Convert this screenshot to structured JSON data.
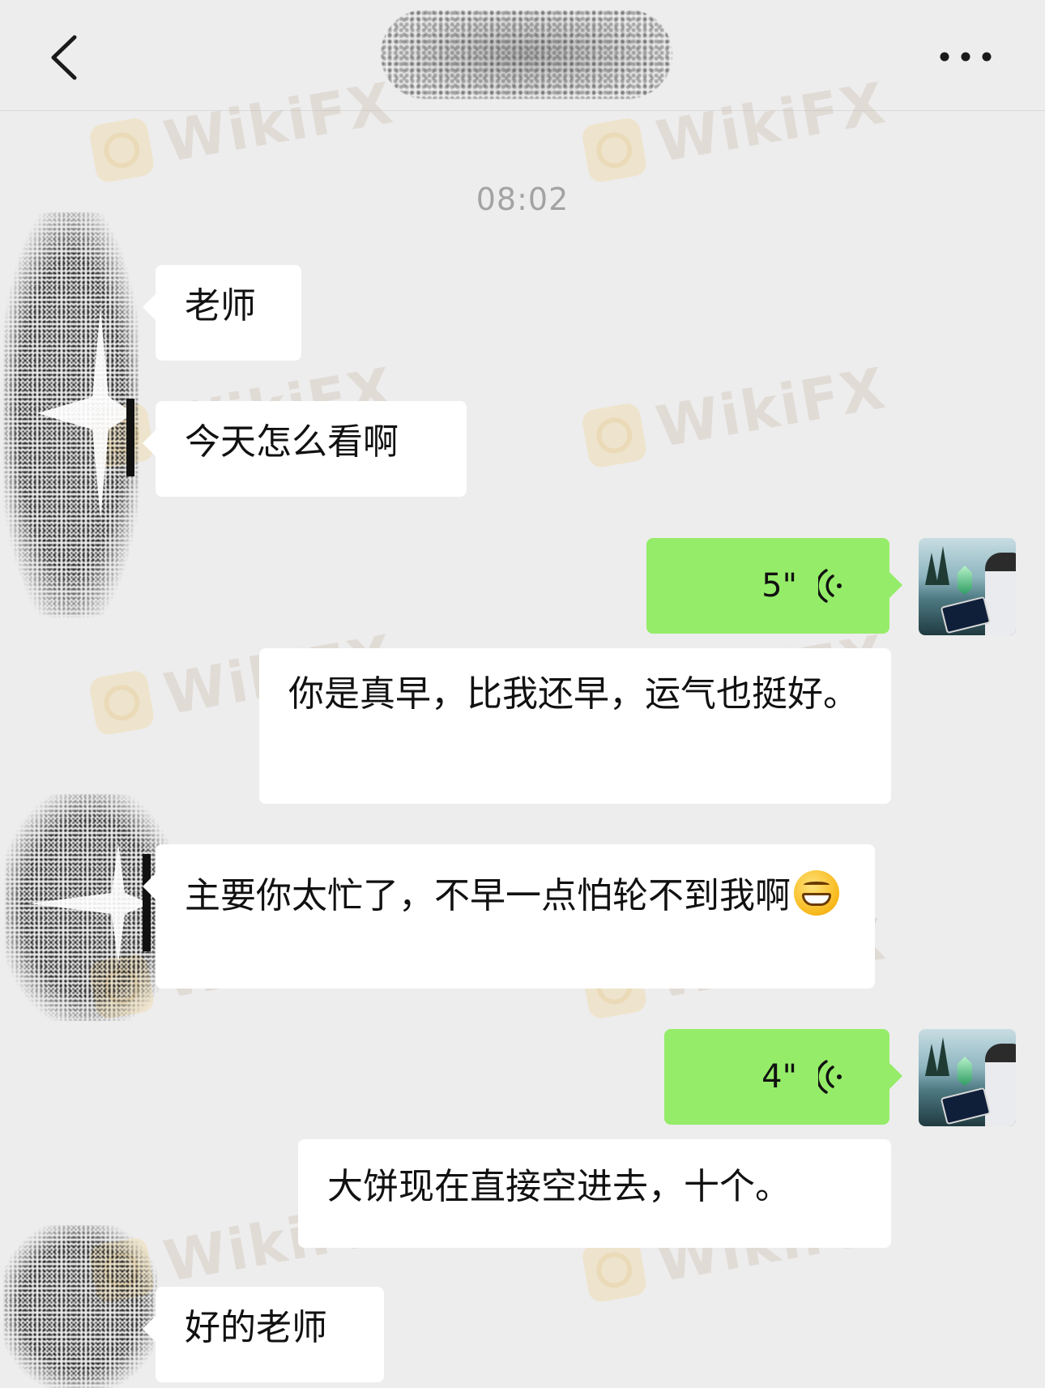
{
  "header": {
    "back_icon": "chevron-left-icon",
    "more_icon": "more-horizontal-icon"
  },
  "timestamp": "08:02",
  "watermark_text": "WikiFX",
  "messages": [
    {
      "side": "left",
      "type": "text",
      "text": "老师"
    },
    {
      "side": "left",
      "type": "text",
      "text": "今天怎么看啊"
    },
    {
      "side": "right",
      "type": "voice",
      "duration": "5\""
    },
    {
      "side": "right",
      "type": "text",
      "text": "你是真早，比我还早，运气也挺好。"
    },
    {
      "side": "left",
      "type": "text",
      "text": "主要你太忙了，不早一点怕轮不到我啊",
      "emoji": "grinning-face-emoji"
    },
    {
      "side": "right",
      "type": "voice",
      "duration": "4\""
    },
    {
      "side": "right",
      "type": "text",
      "text": "大饼现在直接空进去，十个。"
    },
    {
      "side": "left",
      "type": "text",
      "text": "好的老师"
    }
  ],
  "colors": {
    "background": "#ededed",
    "bubble_white": "#ffffff",
    "bubble_green": "#95ec69",
    "timestamp": "#a3a3a3"
  }
}
